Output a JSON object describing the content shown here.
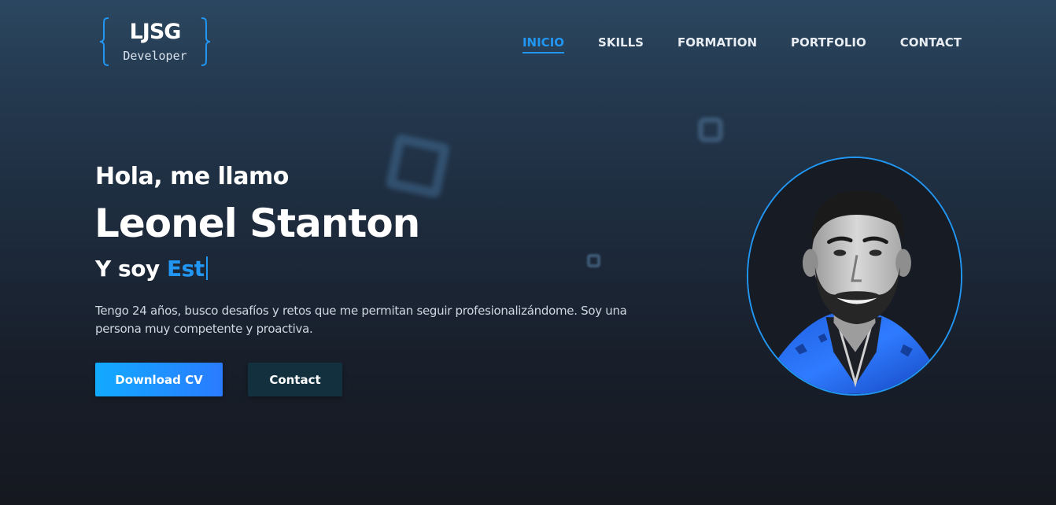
{
  "logo": {
    "title": "LJSG",
    "subtitle": "Developer"
  },
  "nav": {
    "items": [
      {
        "label": "INICIO",
        "active": true
      },
      {
        "label": "SKILLS",
        "active": false
      },
      {
        "label": "FORMATION",
        "active": false
      },
      {
        "label": "PORTFOLIO",
        "active": false
      },
      {
        "label": "CONTACT",
        "active": false
      }
    ]
  },
  "hero": {
    "greeting": "Hola, me llamo",
    "name": "Leonel Stanton",
    "role_prefix": "Y soy ",
    "role_typed": "Est",
    "description": "Tengo 24 años, busco desafíos y retos que me permitan seguir profesionalizándome. Soy una persona muy competente y proactiva."
  },
  "buttons": {
    "download_label": "Download CV",
    "contact_label": "Contact"
  },
  "colors": {
    "accent": "#2196f3",
    "gradient_start": "#12aaff",
    "gradient_end": "#2a7bff",
    "contact_button_bg": "#13303f"
  }
}
